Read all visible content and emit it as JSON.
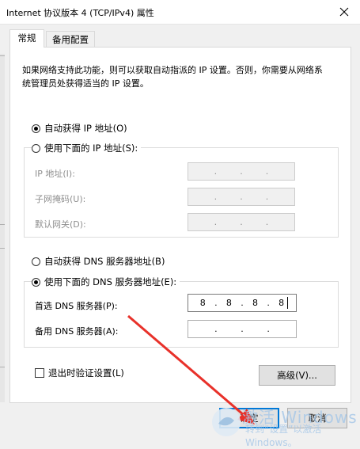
{
  "window": {
    "title": "Internet 协议版本 4 (TCP/IPv4) 属性"
  },
  "tabs": [
    {
      "label": "常规",
      "active": true
    },
    {
      "label": "备用配置",
      "active": false
    }
  ],
  "description": "如果网络支持此功能，则可以获取自动指派的 IP 设置。否则，你需要从网络系统管理员处获得适当的 IP 设置。",
  "ip_section": {
    "auto_label": "自动获得 IP 地址(O)",
    "manual_label": "使用下面的 IP 地址(S):",
    "selected": "auto",
    "fields": [
      {
        "label": "IP 地址(I):",
        "octets": [
          "",
          "",
          "",
          ""
        ]
      },
      {
        "label": "子网掩码(U):",
        "octets": [
          "",
          "",
          "",
          ""
        ]
      },
      {
        "label": "默认网关(D):",
        "octets": [
          "",
          "",
          "",
          ""
        ]
      }
    ]
  },
  "dns_section": {
    "auto_label": "自动获得 DNS 服务器地址(B)",
    "manual_label": "使用下面的 DNS 服务器地址(E):",
    "selected": "manual",
    "preferred": {
      "label": "首选 DNS 服务器(P):",
      "octets": [
        "8",
        "8",
        "8",
        "8"
      ]
    },
    "alternate": {
      "label": "备用 DNS 服务器(A):",
      "octets": [
        "",
        "",
        "",
        ""
      ]
    }
  },
  "validate_on_exit": {
    "label": "退出时验证设置(L)",
    "checked": false
  },
  "buttons": {
    "advanced": "高级(V)...",
    "ok": "确定",
    "cancel": "取消"
  },
  "watermark": {
    "line1": "激活 Windows",
    "line2": "转到“设置”以激活 Windows。"
  },
  "colors": {
    "accent": "#0078d7",
    "arrow": "#e8312a"
  }
}
